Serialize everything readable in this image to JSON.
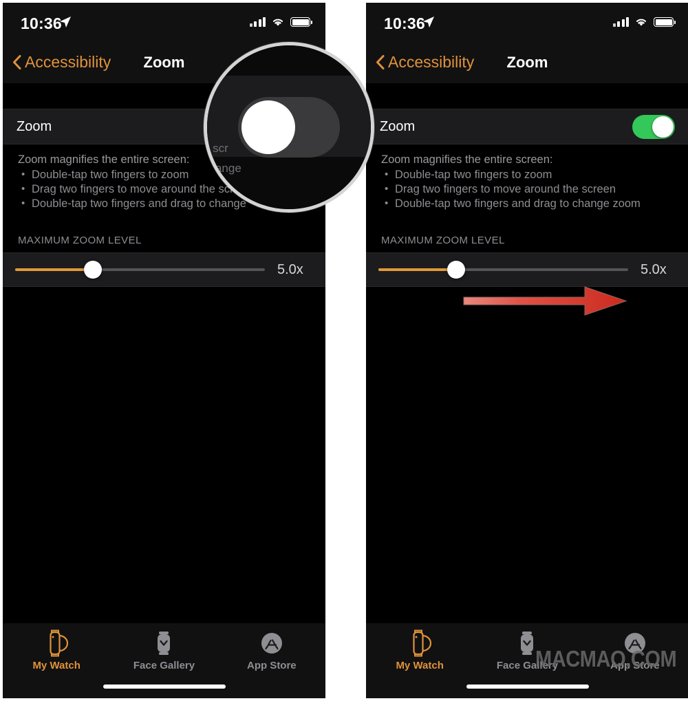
{
  "status_bar": {
    "time": "10:36",
    "location_icon": "location-arrow-icon",
    "cellular_icon": "cellular-signal-icon",
    "wifi_icon": "wifi-icon",
    "battery_icon": "battery-icon"
  },
  "nav": {
    "back_label": "Accessibility",
    "back_icon": "chevron-left-icon",
    "title": "Zoom"
  },
  "zoom_row": {
    "label": "Zoom",
    "toggle_off_state": "off",
    "toggle_on_state": "on"
  },
  "description": {
    "lead": "Zoom magnifies the entire screen:",
    "bullets": [
      "Double-tap two fingers to zoom",
      "Drag two fingers to move around the screen",
      "Double-tap two fingers and drag to change zoom"
    ],
    "bullets_clipped": [
      "Double-tap two fingers to zoom",
      "Drag two fingers to move around the scr",
      "Double-tap two fingers and drag to change"
    ]
  },
  "section": {
    "header": "MAXIMUM ZOOM LEVEL"
  },
  "slider": {
    "value_label": "5.0x",
    "fill_percent": 31
  },
  "tabbar": {
    "items": [
      {
        "label": "My Watch",
        "icon": "apple-watch-icon",
        "active": true
      },
      {
        "label": "Face Gallery",
        "icon": "watch-face-icon",
        "active": false
      },
      {
        "label": "App Store",
        "icon": "app-store-icon",
        "active": false
      }
    ]
  },
  "loupe": {
    "magnified_text_line_1": "e scr",
    "magnified_text_line_2": "change"
  },
  "annotation": {
    "arrow_icon": "red-right-arrow-icon",
    "arrow_color": "#D8352A"
  },
  "watermark": {
    "text": "MACMAO.COM"
  },
  "colors": {
    "accent_orange": "#E0923A",
    "toggle_on_green": "#34C759",
    "toggle_off_gray": "#39393C",
    "slider_orange": "#E09A38",
    "row_background": "#1C1C1E",
    "screen_background": "#000000",
    "secondary_text": "#8E8E93"
  }
}
